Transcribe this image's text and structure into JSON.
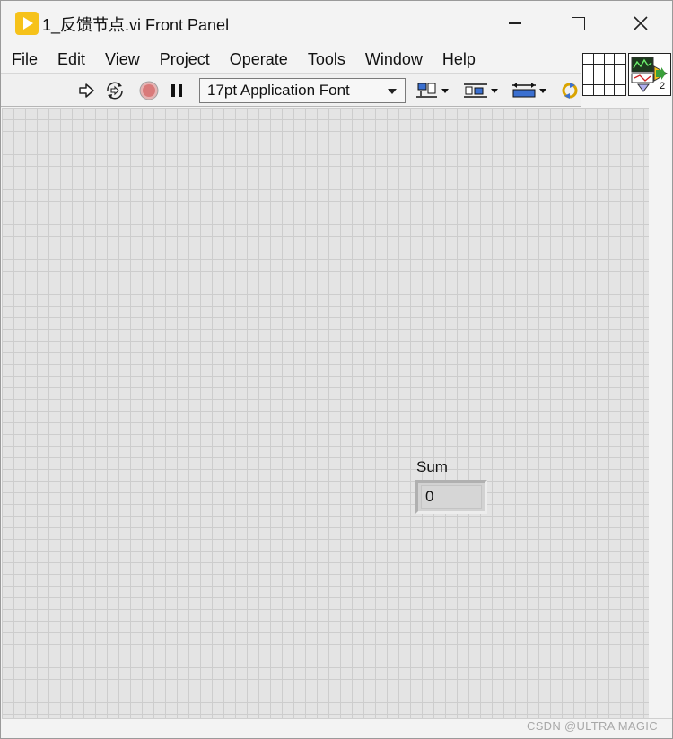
{
  "window": {
    "title": "1_反馈节点.vi Front Panel"
  },
  "menu": {
    "items": [
      "File",
      "Edit",
      "View",
      "Project",
      "Operate",
      "Tools",
      "Window",
      "Help"
    ]
  },
  "toolbar": {
    "font_select_value": "17pt Application Font",
    "icons": [
      "run-arrow-icon",
      "run-continuously-icon",
      "abort-icon",
      "pause-icon",
      "align-objects-icon",
      "distribute-objects-icon",
      "resize-objects-icon",
      "reorder-icon"
    ]
  },
  "vi_icon": {
    "badge": "2"
  },
  "indicator": {
    "label": "Sum",
    "value": "0"
  },
  "watermark": "CSDN @ULTRA MAGIC",
  "colors": {
    "app_icon": "#f6c21a",
    "canvas": "#e4e4e4",
    "grid": "#cdcdcd",
    "abort_button": "#d97a7a"
  }
}
